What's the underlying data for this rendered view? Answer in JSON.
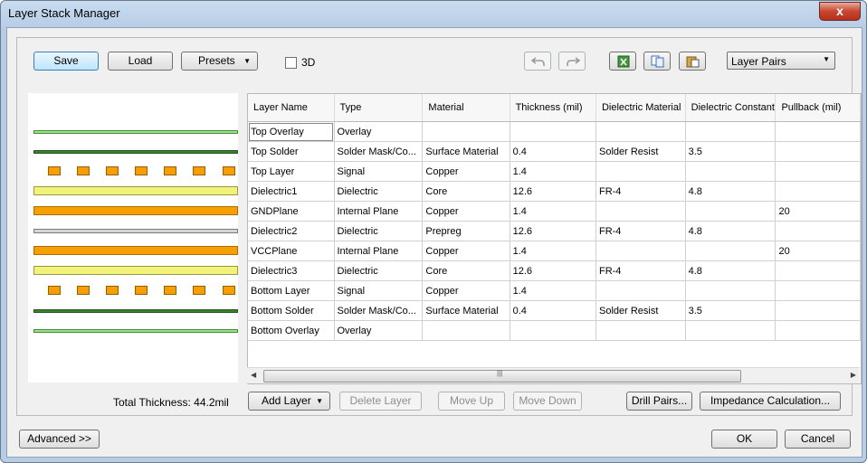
{
  "window": {
    "title": "Layer Stack Manager",
    "close_glyph": "x"
  },
  "toolbar": {
    "save_label": "Save",
    "load_label": "Load",
    "presets_label": "Presets",
    "three_d_label": "3D",
    "layer_pairs_value": "Layer Pairs",
    "icons": [
      "undo-icon",
      "redo-icon",
      "export-excel-icon",
      "copy-icon",
      "paste-icon"
    ]
  },
  "grid": {
    "columns": [
      "Layer Name",
      "Type",
      "Material",
      "Thickness (mil)",
      "Dielectric Material",
      "Dielectric Constant",
      "Pullback (mil)"
    ],
    "rows": [
      [
        "Top Overlay",
        "Overlay",
        "",
        "",
        "",
        "",
        ""
      ],
      [
        "Top Solder",
        "Solder Mask/Co...",
        "Surface Material",
        "0.4",
        "Solder Resist",
        "3.5",
        ""
      ],
      [
        "Top Layer",
        "Signal",
        "Copper",
        "1.4",
        "",
        "",
        ""
      ],
      [
        "Dielectric1",
        "Dielectric",
        "Core",
        "12.6",
        "FR-4",
        "4.8",
        ""
      ],
      [
        "GNDPlane",
        "Internal Plane",
        "Copper",
        "1.4",
        "",
        "",
        "20"
      ],
      [
        "Dielectric2",
        "Dielectric",
        "Prepreg",
        "12.6",
        "FR-4",
        "4.8",
        ""
      ],
      [
        "VCCPlane",
        "Internal Plane",
        "Copper",
        "1.4",
        "",
        "",
        "20"
      ],
      [
        "Dielectric3",
        "Dielectric",
        "Core",
        "12.6",
        "FR-4",
        "4.8",
        ""
      ],
      [
        "Bottom Layer",
        "Signal",
        "Copper",
        "1.4",
        "",
        "",
        ""
      ],
      [
        "Bottom Solder",
        "Solder Mask/Co...",
        "Surface Material",
        "0.4",
        "Solder Resist",
        "3.5",
        ""
      ],
      [
        "Bottom Overlay",
        "Overlay",
        "",
        "",
        "",
        "",
        ""
      ]
    ]
  },
  "footer": {
    "total_thickness": "Total Thickness: 44.2mil",
    "add_layer_label": "Add Layer",
    "delete_layer_label": "Delete Layer",
    "move_up_label": "Move Up",
    "move_down_label": "Move Down",
    "drill_pairs_label": "Drill Pairs...",
    "impedance_label": "Impedance Calculation..."
  },
  "bottom": {
    "advanced_label": "Advanced >>",
    "ok_label": "OK",
    "cancel_label": "Cancel"
  },
  "colors": {
    "overlay": "#9be08f",
    "solder": "#3a7f2e",
    "copper": "#f5a000",
    "core": "#f2f27a",
    "prepreg": "#d5d5d5",
    "close_button": "#c7462f"
  }
}
